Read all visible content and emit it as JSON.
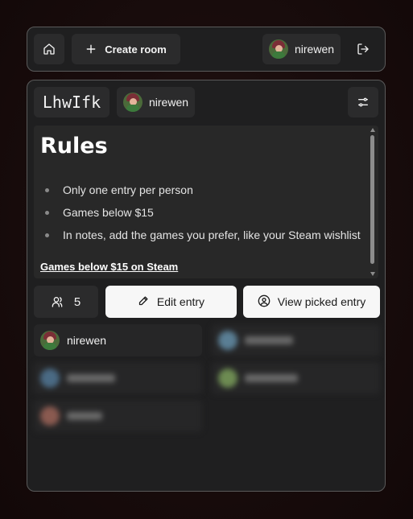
{
  "topbar": {
    "create_room_label": "Create room",
    "username": "nirewen"
  },
  "room": {
    "code": "LhwIfk",
    "owner_name": "nirewen",
    "rules": {
      "title": "Rules",
      "items": [
        "Only one entry per person",
        "Games below $15",
        "In notes, add the games you prefer, like your Steam wishlist"
      ],
      "link_text": "Games below $15 on Steam"
    },
    "participant_count": "5",
    "edit_entry_label": "Edit entry",
    "view_picked_label": "View picked entry",
    "members": [
      {
        "name": "nirewen",
        "blurred": false
      },
      {
        "name": "",
        "blurred": true,
        "color": "#5a7e94"
      },
      {
        "name": "",
        "blurred": true,
        "color": "#4a6a84"
      },
      {
        "name": "",
        "blurred": true,
        "color": "#6d8b52"
      },
      {
        "name": "",
        "blurred": true,
        "color": "#8a5a50"
      }
    ]
  },
  "colors": {
    "panel_bg": "#1f1f20",
    "button_bg": "#2b2b2c",
    "primary_button_bg": "#f7f7f7",
    "background": "#1a0d0d"
  }
}
